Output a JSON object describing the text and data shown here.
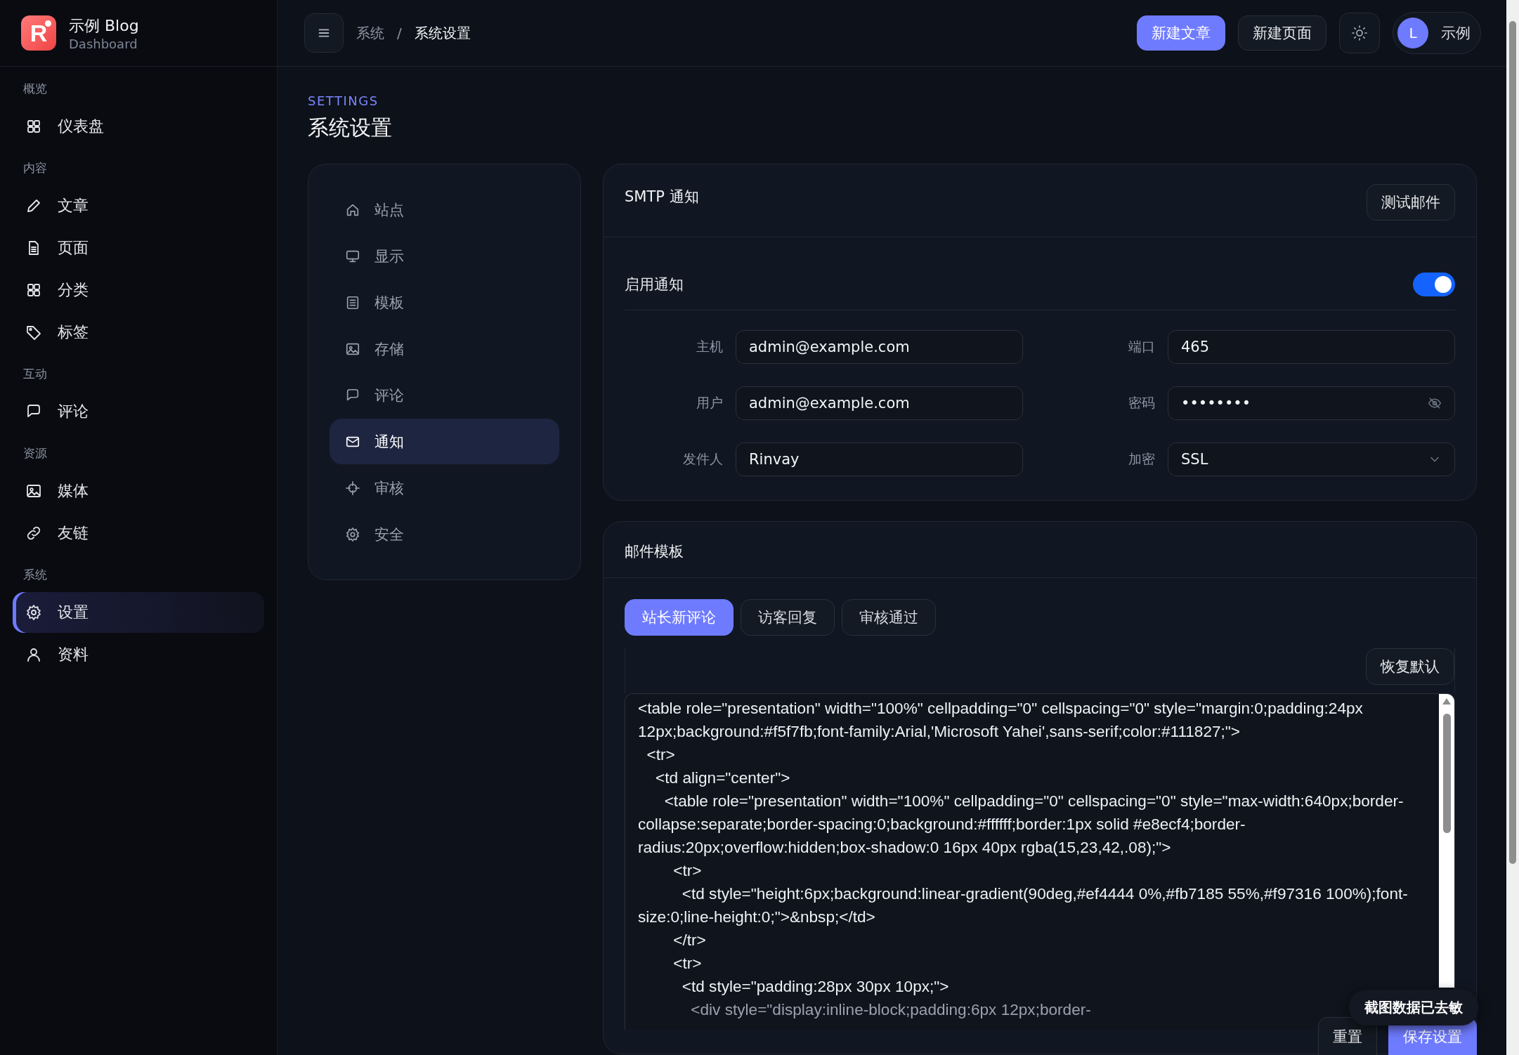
{
  "brand": {
    "logo_letter": "R",
    "title": "示例 Blog",
    "subtitle": "Dashboard"
  },
  "sidebar": {
    "sections": [
      {
        "label": "概览",
        "items": [
          {
            "label": "仪表盘",
            "selected": false
          }
        ]
      },
      {
        "label": "内容",
        "items": [
          {
            "label": "文章",
            "selected": false
          },
          {
            "label": "页面",
            "selected": false
          },
          {
            "label": "分类",
            "selected": false
          },
          {
            "label": "标签",
            "selected": false
          }
        ]
      },
      {
        "label": "互动",
        "items": [
          {
            "label": "评论",
            "selected": false
          }
        ]
      },
      {
        "label": "资源",
        "items": [
          {
            "label": "媒体",
            "selected": false
          },
          {
            "label": "友链",
            "selected": false
          }
        ]
      },
      {
        "label": "系统",
        "items": [
          {
            "label": "设置",
            "selected": true
          },
          {
            "label": "资料",
            "selected": false
          }
        ]
      }
    ]
  },
  "topbar": {
    "breadcrumb": [
      "系统",
      "系统设置"
    ],
    "separator": "/",
    "buttons": [
      {
        "label": "新建文章",
        "kind": "primary"
      },
      {
        "label": "新建页面",
        "kind": "secondary"
      }
    ],
    "user": {
      "initial": "L",
      "name": "示例"
    }
  },
  "page": {
    "eyebrow": "SETTINGS",
    "title": "系统设置"
  },
  "settings_nav": [
    {
      "label": "站点",
      "selected": false
    },
    {
      "label": "显示",
      "selected": false
    },
    {
      "label": "模板",
      "selected": false
    },
    {
      "label": "存储",
      "selected": false
    },
    {
      "label": "评论",
      "selected": false
    },
    {
      "label": "通知",
      "selected": true
    },
    {
      "label": "审核",
      "selected": false
    },
    {
      "label": "安全",
      "selected": false
    }
  ],
  "smtp": {
    "title": "SMTP 通知",
    "test_button": "测试邮件",
    "enable": {
      "label": "启用通知",
      "on": true
    },
    "fields": [
      {
        "label": "主机",
        "value": "admin@example.com",
        "kind": "text"
      },
      {
        "label": "端口",
        "value": "465",
        "kind": "text"
      },
      {
        "label": "用户",
        "value": "admin@example.com",
        "kind": "text"
      },
      {
        "label": "密码",
        "value": "••••••••",
        "kind": "password"
      },
      {
        "label": "发件人",
        "value": "Rinvay",
        "kind": "text"
      },
      {
        "label": "加密",
        "value": "SSL",
        "kind": "select"
      }
    ]
  },
  "template": {
    "title": "邮件模板",
    "tabs": [
      {
        "label": "站长新评论",
        "selected": true
      },
      {
        "label": "访客回复",
        "selected": false
      },
      {
        "label": "审核通过",
        "selected": false
      }
    ],
    "restore_button": "恢复默认",
    "code_lines": [
      "<table role=\"presentation\" width=\"100%\" cellpadding=\"0\" cellspacing=\"0\" style=\"margin:0;padding:24px 12px;background:#f5f7fb;font-family:Arial,'Microsoft Yahei',sans-serif;color:#111827;\">",
      "  <tr>",
      "    <td align=\"center\">",
      "      <table role=\"presentation\" width=\"100%\" cellpadding=\"0\" cellspacing=\"0\" style=\"max-width:640px;border-collapse:separate;border-spacing:0;background:#ffffff;border:1px solid #e8ecf4;border-radius:20px;overflow:hidden;box-shadow:0 16px 40px rgba(15,23,42,.08);\">",
      "        <tr>",
      "          <td style=\"height:6px;background:linear-gradient(90deg,#ef4444 0%,#fb7185 55%,#f97316 100%);font-size:0;line-height:0;\">&nbsp;</td>",
      "        </tr>",
      "        <tr>",
      "          <td style=\"padding:28px 30px 10px;\">",
      "            <div style=\"display:inline-block;padding:6px 12px;border-"
    ]
  },
  "actions": [
    {
      "label": "重置",
      "kind": "secondary"
    },
    {
      "label": "保存设置",
      "kind": "primary"
    }
  ],
  "toast": "截图数据已去敏"
}
